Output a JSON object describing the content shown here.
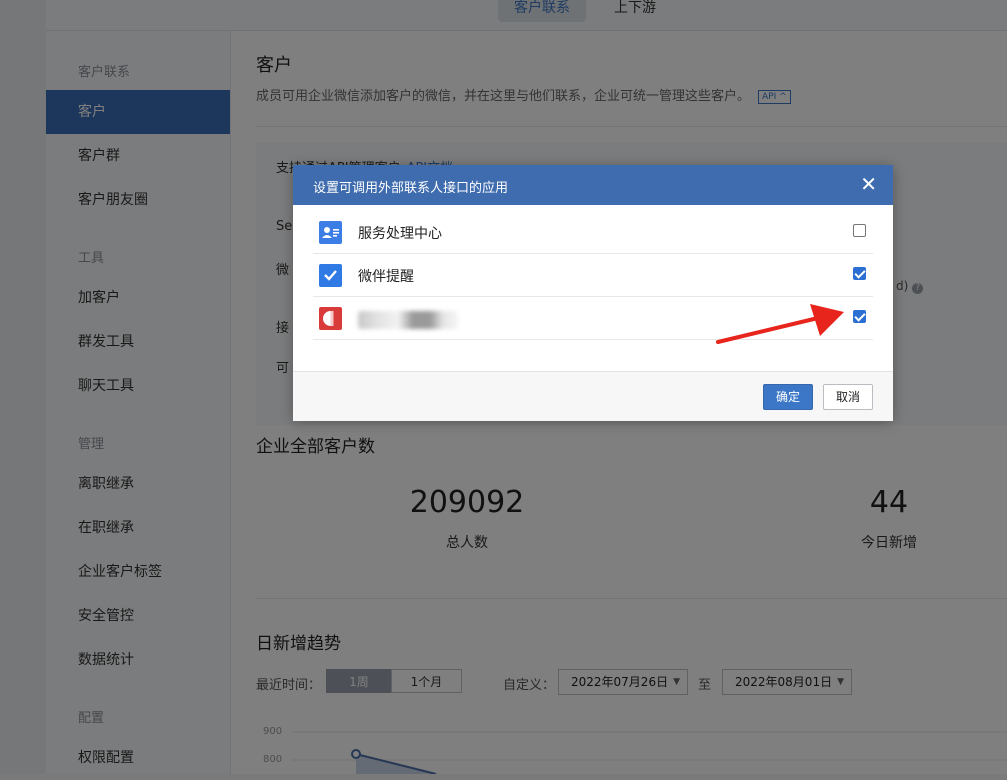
{
  "topbar": {
    "tabs": [
      {
        "label": "客户联系",
        "active": true
      },
      {
        "label": "上下游",
        "active": false
      }
    ]
  },
  "sidebar": {
    "groups": [
      {
        "label": "客户联系",
        "items": [
          {
            "label": "客户",
            "active": true
          },
          {
            "label": "客户群"
          },
          {
            "label": "客户朋友圈"
          }
        ]
      },
      {
        "label": "工具",
        "items": [
          {
            "label": "加客户"
          },
          {
            "label": "群发工具"
          },
          {
            "label": "聊天工具"
          }
        ]
      },
      {
        "label": "管理",
        "items": [
          {
            "label": "离职继承"
          },
          {
            "label": "在职继承"
          },
          {
            "label": "企业客户标签"
          },
          {
            "label": "安全管控"
          },
          {
            "label": "数据统计"
          }
        ]
      },
      {
        "label": "配置",
        "items": [
          {
            "label": "权限配置"
          }
        ]
      }
    ]
  },
  "main": {
    "title": "客户",
    "description": "成员可用企业微信添加客户的微信，并在这里与他们联系，企业可统一管理这些客户。",
    "api_badge": "API ^",
    "api_box": {
      "title": "支持通过API管理客户",
      "link": "API文档",
      "row_labels": [
        "Se",
        "微",
        "接",
        "可"
      ],
      "suffix": "d)",
      "help_icon": "question-icon"
    },
    "stats": {
      "title": "企业全部客户数",
      "total": {
        "value": "209092",
        "label": "总人数"
      },
      "today": {
        "value": "44",
        "label": "今日新增"
      }
    },
    "trend": {
      "title": "日新增趋势",
      "recent_label": "最近时间：",
      "range_options": [
        "1周",
        "1个月"
      ],
      "custom_label": "自定义：",
      "start_date": "2022年07月26日",
      "to_label": "至",
      "end_date": "2022年08月01日",
      "y_ticks": [
        "900",
        "800"
      ]
    }
  },
  "chart_data": {
    "type": "line",
    "ylabel": "",
    "y_ticks": [
      800,
      900
    ],
    "series": [
      {
        "values": [
          850
        ]
      }
    ]
  },
  "dialog": {
    "title": "设置可调用外部联系人接口的应用",
    "close_glyph": "✕",
    "apps": [
      {
        "name": "服务处理中心",
        "checked": false,
        "icon": "contact-card-icon",
        "icon_color": "#3d7ee6"
      },
      {
        "name": "微伴提醒",
        "checked": true,
        "icon": "chat-check-icon",
        "icon_color": "#2f7ae5"
      },
      {
        "name": "",
        "checked": true,
        "icon": "app-logo-icon",
        "icon_color": "#d93a3a",
        "name_redacted": true
      }
    ],
    "ok_label": "确定",
    "cancel_label": "取消"
  },
  "colors": {
    "accent": "#3b77c6",
    "dialog_header": "#3f6cae",
    "sidebar_active": "#3b6db6",
    "arrow": "#e8251c"
  }
}
